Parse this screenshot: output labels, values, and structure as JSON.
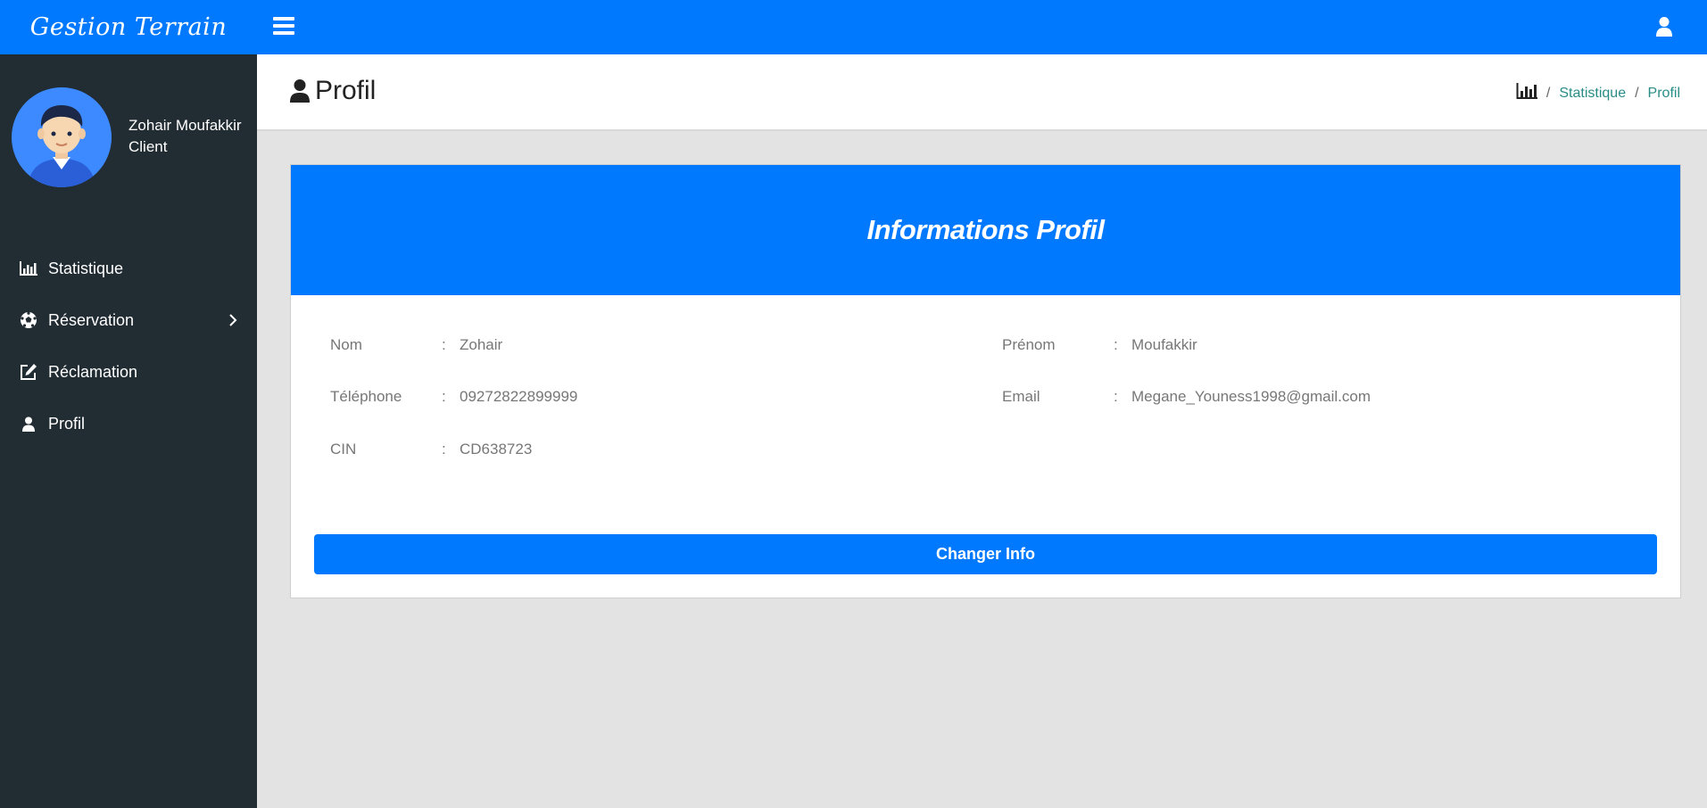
{
  "topbar": {
    "brand": "Gestion Terrain",
    "menu_icon": "hamburger-icon",
    "user_icon": "user-icon"
  },
  "sidebar": {
    "user_name": "Zohair Moufakkir",
    "user_role": "Client",
    "items": [
      {
        "label": "Statistique",
        "icon": "bar-chart-icon"
      },
      {
        "label": "Réservation",
        "icon": "soccer-ball-icon",
        "has_submenu": true
      },
      {
        "label": "Réclamation",
        "icon": "edit-icon"
      },
      {
        "label": "Profil",
        "icon": "user-icon"
      }
    ]
  },
  "header": {
    "title": "Profil",
    "breadcrumb": [
      "Statistique",
      "Profil"
    ]
  },
  "card": {
    "title": "Informations Profil",
    "fields": {
      "nom": {
        "label": "Nom",
        "value": "Zohair"
      },
      "prenom": {
        "label": "Prénom",
        "value": "Moufakkir"
      },
      "telephone": {
        "label": "Téléphone",
        "value": "09272822899999"
      },
      "email": {
        "label": "Email",
        "value": "Megane_Youness1998@gmail.com"
      },
      "cin": {
        "label": "CIN",
        "value": "CD638723"
      }
    },
    "separator": ":",
    "button_label": "Changer Info"
  },
  "colors": {
    "primary": "#0179fe",
    "sidebar_bg": "#222c33",
    "content_bg": "#e3e3e3",
    "breadcrumb_link": "#2a8c86"
  }
}
